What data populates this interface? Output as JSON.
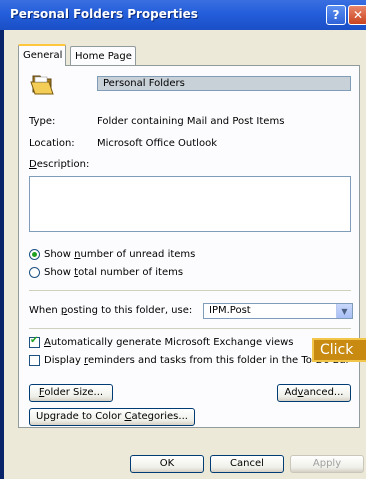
{
  "window": {
    "title": "Personal Folders Properties"
  },
  "tabs": [
    {
      "label": "General",
      "active": true
    },
    {
      "label": "Home Page",
      "active": false
    }
  ],
  "general": {
    "folder_name": "Personal Folders",
    "type_label": "Type:",
    "type_value": "Folder containing Mail and Post Items",
    "location_label": "Location:",
    "location_value": "Microsoft Office Outlook",
    "description_label_pre": "",
    "description_label_key": "D",
    "description_label_post": "escription:",
    "description_value": "",
    "radio_unread": {
      "pre": "Show ",
      "key": "n",
      "post": "umber of unread items",
      "selected": true
    },
    "radio_total": {
      "pre": "Show ",
      "key": "t",
      "post": "otal number of items",
      "selected": false
    },
    "posting_label": {
      "pre": "When ",
      "key": "p",
      "post": "osting to this folder, use:"
    },
    "posting_value": "IPM.Post",
    "check_exchange": {
      "pre": "",
      "key": "A",
      "post": "utomatically generate Microsoft Exchange views",
      "checked": true
    },
    "check_reminders": {
      "pre": "Display ",
      "key": "r",
      "post": "eminders and tasks from this folder in the To-Do Bar",
      "checked": false
    }
  },
  "buttons": {
    "folder_size": {
      "pre": "",
      "key": "F",
      "post": "older Size..."
    },
    "advanced": {
      "pre": "Ad",
      "key": "v",
      "post": "anced..."
    },
    "upgrade": {
      "pre": "Upgrade to Color ",
      "key": "C",
      "post": "ategories..."
    },
    "ok": "OK",
    "cancel": "Cancel",
    "apply": "Apply"
  },
  "callout": {
    "text": "Click"
  },
  "colors": {
    "title_bar": "#245edb",
    "dialog_bg": "#ece9d8",
    "callout_bg": "#c88a10",
    "callout_border": "#f1c64a"
  },
  "icons": [
    "help-icon",
    "close-icon",
    "folder-icon",
    "dropdown-arrow-icon"
  ]
}
